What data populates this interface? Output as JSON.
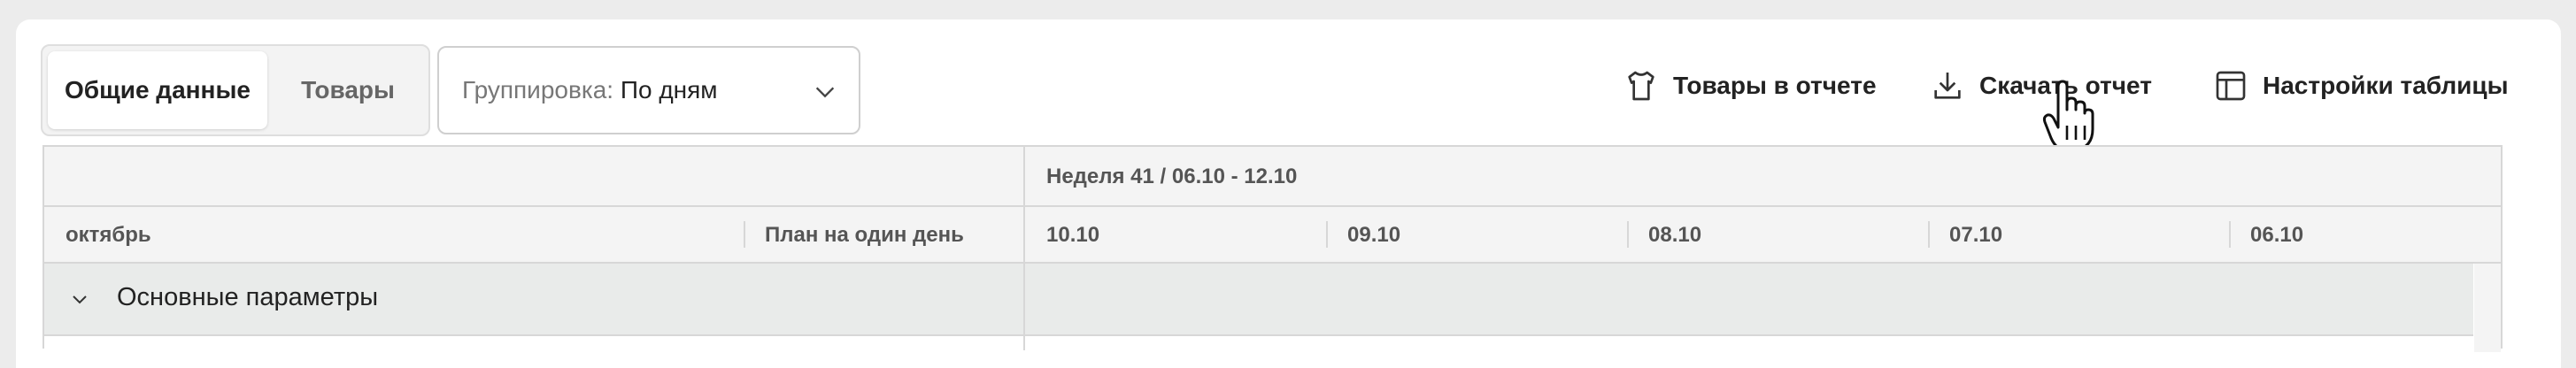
{
  "toolbar": {
    "tabs": [
      {
        "label": "Общие данные",
        "active": true
      },
      {
        "label": "Товары",
        "active": false
      }
    ],
    "grouping": {
      "label": "Группировка:",
      "value": "По дням"
    },
    "actions": [
      {
        "label": "Товары в отчете",
        "icon": "tshirt-icon"
      },
      {
        "label": "Скачать отчет",
        "icon": "download-icon"
      },
      {
        "label": "Настройки таблицы",
        "icon": "table-settings-icon"
      }
    ]
  },
  "table": {
    "week_header": "Неделя 41 / 06.10 - 12.10",
    "month_col": "октябрь",
    "plan_col": "План на один день",
    "days": [
      "10.10",
      "09.10",
      "08.10",
      "07.10",
      "06.10"
    ],
    "section_title": "Основные параметры"
  }
}
